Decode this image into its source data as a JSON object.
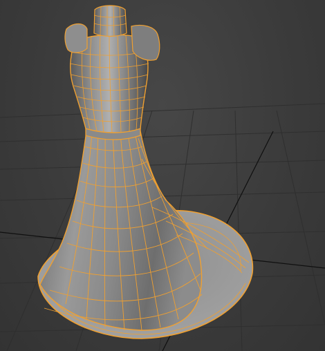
{
  "viewport": {
    "kind": "3d-modeling-perspective-view",
    "shading": "wireframe-on-shaded",
    "colors": {
      "background": "#3a3a3a",
      "grid_line": "#2e2e2e",
      "axis_line": "#0e0e0e",
      "mesh_fill_light": "#a8a8a8",
      "mesh_fill_dark": "#4a4a4a",
      "wireframe": "#f0a030"
    }
  },
  "model": {
    "object": "dress-on-mannequin-mesh",
    "state": "selected"
  }
}
